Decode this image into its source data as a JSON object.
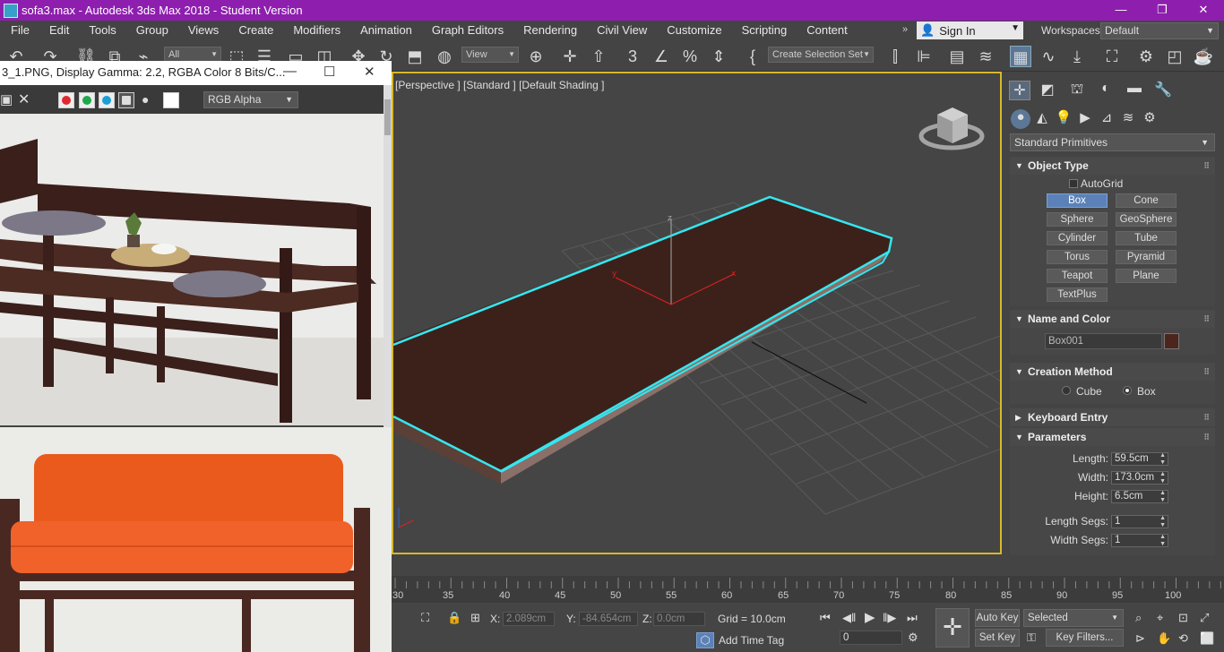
{
  "window": {
    "title": "sofa3.max - Autodesk 3ds Max 2018 - Student Version",
    "controls": [
      "—",
      "❐",
      "✕"
    ]
  },
  "menu": [
    "File",
    "Edit",
    "Tools",
    "Group",
    "Views",
    "Create",
    "Modifiers",
    "Animation",
    "Graph Editors",
    "Rendering",
    "Civil View",
    "Customize",
    "Scripting",
    "Content"
  ],
  "account": {
    "sign_in": "Sign In",
    "workspaces_label": "Workspaces:",
    "workspace": "Default",
    "more": "»"
  },
  "toolbar": {
    "filter": "All",
    "ref_coord": "View",
    "selection_set": "Create Selection Set"
  },
  "framebuffer": {
    "title": "3_1.PNG, Display Gamma: 2.2, RGBA Color 8 Bits/C...",
    "channel": "RGB Alpha",
    "swatch_colors": [
      "#e0282e",
      "#1fa84a",
      "#19a0d8"
    ]
  },
  "viewport": {
    "label": "[Perspective ] [Standard ] [Default Shading ]",
    "object_color": "#3c211a",
    "selection_color": "#35e6f0"
  },
  "command_panel": {
    "category": "Standard Primitives",
    "object_type": {
      "header": "Object Type",
      "autogrid": "AutoGrid",
      "buttons": [
        "Box",
        "Cone",
        "Sphere",
        "GeoSphere",
        "Cylinder",
        "Tube",
        "Torus",
        "Pyramid",
        "Teapot",
        "Plane",
        "TextPlus"
      ],
      "active": "Box"
    },
    "name_and_color": {
      "header": "Name and Color",
      "name": "Box001",
      "color": "#4c261c"
    },
    "creation_method": {
      "header": "Creation Method",
      "options": [
        "Cube",
        "Box"
      ],
      "selected": "Box"
    },
    "keyboard_entry": {
      "header": "Keyboard Entry"
    },
    "parameters": {
      "header": "Parameters",
      "length_label": "Length:",
      "length": "59.5cm",
      "width_label": "Width:",
      "width": "173.0cm",
      "height_label": "Height:",
      "height": "6.5cm",
      "length_segs_label": "Length Segs:",
      "length_segs": "1",
      "width_segs_label": "Width Segs:",
      "width_segs": "1"
    }
  },
  "timeline": {
    "ticks": [
      "30",
      "35",
      "40",
      "45",
      "50",
      "55",
      "60",
      "65",
      "70",
      "75",
      "80",
      "85",
      "90",
      "95",
      "100"
    ]
  },
  "status": {
    "x_label": "X:",
    "x": "2.089cm",
    "y_label": "Y:",
    "y": "-84.654cm",
    "z_label": "Z:",
    "z": "0.0cm",
    "grid": "Grid = 10.0cm",
    "add_time_tag": "Add Time Tag",
    "auto_key": "Auto Key",
    "set_key": "Set Key",
    "selected": "Selected",
    "key_filters": "Key Filters...",
    "frame": "0"
  }
}
